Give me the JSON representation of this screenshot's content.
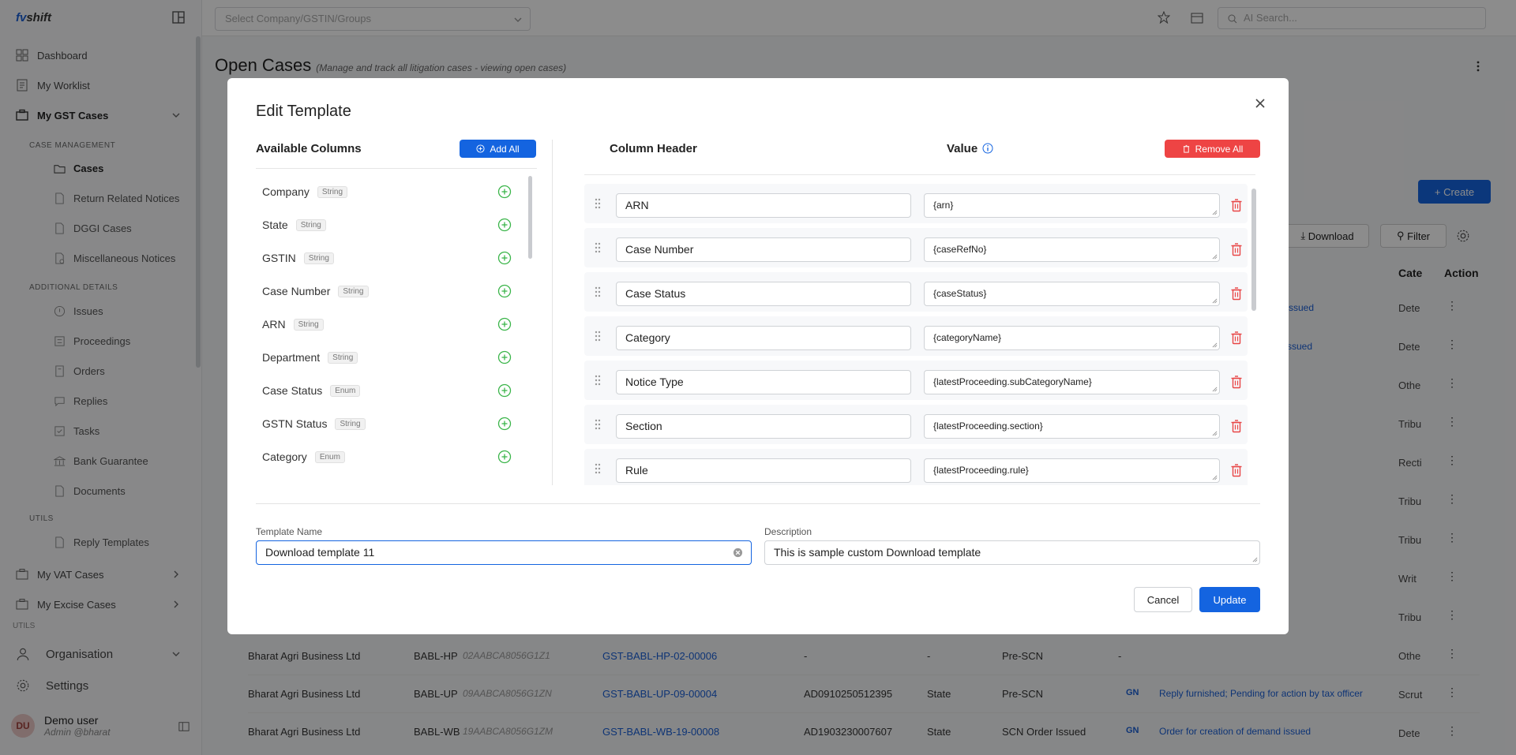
{
  "app": {
    "logo_fv": "fv",
    "logo_rest": "shift"
  },
  "header": {
    "company_placeholder": "Select Company/GSTIN/Groups",
    "ai_search_placeholder": "AI Search..."
  },
  "sidebar": {
    "dashboard": "Dashboard",
    "worklist": "My Worklist",
    "gst_cases": "My GST Cases",
    "case_management": "CASE MANAGEMENT",
    "cases": "Cases",
    "return_notices": "Return Related Notices",
    "dggi": "DGGI Cases",
    "misc": "Miscellaneous Notices",
    "additional": "ADDITIONAL DETAILS",
    "issues": "Issues",
    "proceedings": "Proceedings",
    "orders": "Orders",
    "replies": "Replies",
    "tasks": "Tasks",
    "bank_guarantee": "Bank Guarantee",
    "documents": "Documents",
    "utils": "UTILS",
    "reply_templates": "Reply Templates",
    "vat": "My VAT Cases",
    "excise": "My Excise Cases",
    "utils2": "UTILS",
    "organisation": "Organisation",
    "settings": "Settings",
    "user_initials": "DU",
    "user_name": "Demo user",
    "user_role": "Admin @bharat"
  },
  "page": {
    "title": "Open Cases",
    "subtitle": "(Manage and track all litigation cases - viewing open cases)",
    "create": "Create",
    "download": "Download",
    "filter": "Filter",
    "col_cate": "Cate",
    "col_action": "Action"
  },
  "bg_cate": [
    "Dete",
    "Dete",
    "Othe",
    "Tribu",
    "Recti",
    "Tribu",
    "Tribu",
    "Writ",
    "Tribu",
    "Othe",
    "Scrut",
    "Dete"
  ],
  "bg_link_snippets": [
    "s issued",
    "ssued"
  ],
  "bg_rows": [
    {
      "company": "Bharat Agri Business Ltd",
      "code": "BABL-HP",
      "gstin": "02AABCA8056G1Z1",
      "case": "GST-BABL-HP-02-00006",
      "arn": "-",
      "dept": "-",
      "status": "Pre-SCN",
      "note": "-"
    },
    {
      "company": "Bharat Agri Business Ltd",
      "code": "BABL-UP",
      "gstin": "09AABCA8056G1ZN",
      "case": "GST-BABL-UP-09-00004",
      "arn": "AD0910250512395",
      "dept": "State",
      "status": "Pre-SCN",
      "note": "Reply furnished; Pending for action by tax officer"
    },
    {
      "company": "Bharat Agri Business Ltd",
      "code": "BABL-WB",
      "gstin": "19AABCA8056G1ZM",
      "case": "GST-BABL-WB-19-00008",
      "arn": "AD1903230007607",
      "dept": "State",
      "status": "SCN Order Issued",
      "note": "Order for creation of demand issued"
    }
  ],
  "modal": {
    "title": "Edit Template",
    "available_title": "Available Columns",
    "add_all": "Add All",
    "column_header_title": "Column Header",
    "value_title": "Value",
    "remove_all": "Remove All",
    "available_columns": [
      {
        "name": "Company",
        "type": "String"
      },
      {
        "name": "State",
        "type": "String"
      },
      {
        "name": "GSTIN",
        "type": "String"
      },
      {
        "name": "Case Number",
        "type": "String"
      },
      {
        "name": "ARN",
        "type": "String"
      },
      {
        "name": "Department",
        "type": "String"
      },
      {
        "name": "Case Status",
        "type": "Enum"
      },
      {
        "name": "GSTN Status",
        "type": "String"
      },
      {
        "name": "Category",
        "type": "Enum"
      }
    ],
    "mappings": [
      {
        "header": "ARN",
        "value": "{arn}"
      },
      {
        "header": "Case Number",
        "value": "{caseRefNo}"
      },
      {
        "header": "Case Status",
        "value": "{caseStatus}"
      },
      {
        "header": "Category",
        "value": "{categoryName}"
      },
      {
        "header": "Notice Type",
        "value": "{latestProceeding.subCategoryName}"
      },
      {
        "header": "Section",
        "value": "{latestProceeding.section}"
      },
      {
        "header": "Rule",
        "value": "{latestProceeding.rule}"
      }
    ],
    "template_name_label": "Template Name",
    "template_name_value": "Download template 11",
    "description_label": "Description",
    "description_value": "This is sample custom Download template",
    "cancel": "Cancel",
    "update": "Update"
  },
  "colors": {
    "primary": "#1464e0",
    "danger": "#ee4444",
    "success": "#3bb54a"
  }
}
